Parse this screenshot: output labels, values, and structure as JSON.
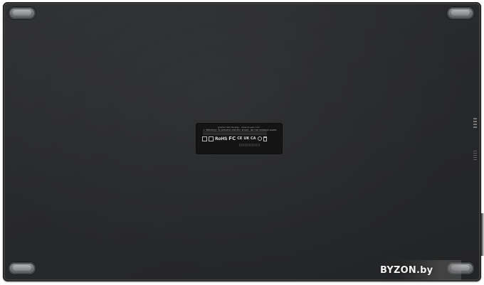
{
  "product_label": {
    "line1": "Graphic Pen Display · www.xp-pen.com",
    "line2": "⚠ Warning: To prevent electric shock, do not remove cover.",
    "rohs": "RoHS",
    "fc": "FC",
    "ce": "CE",
    "ukca": "UK CA"
  },
  "watermark": {
    "text": "BYZON.by"
  },
  "colors": {
    "tablet_body": "#2a2b2d",
    "feet": "#7a7b7d",
    "label_bg": "#141414"
  }
}
